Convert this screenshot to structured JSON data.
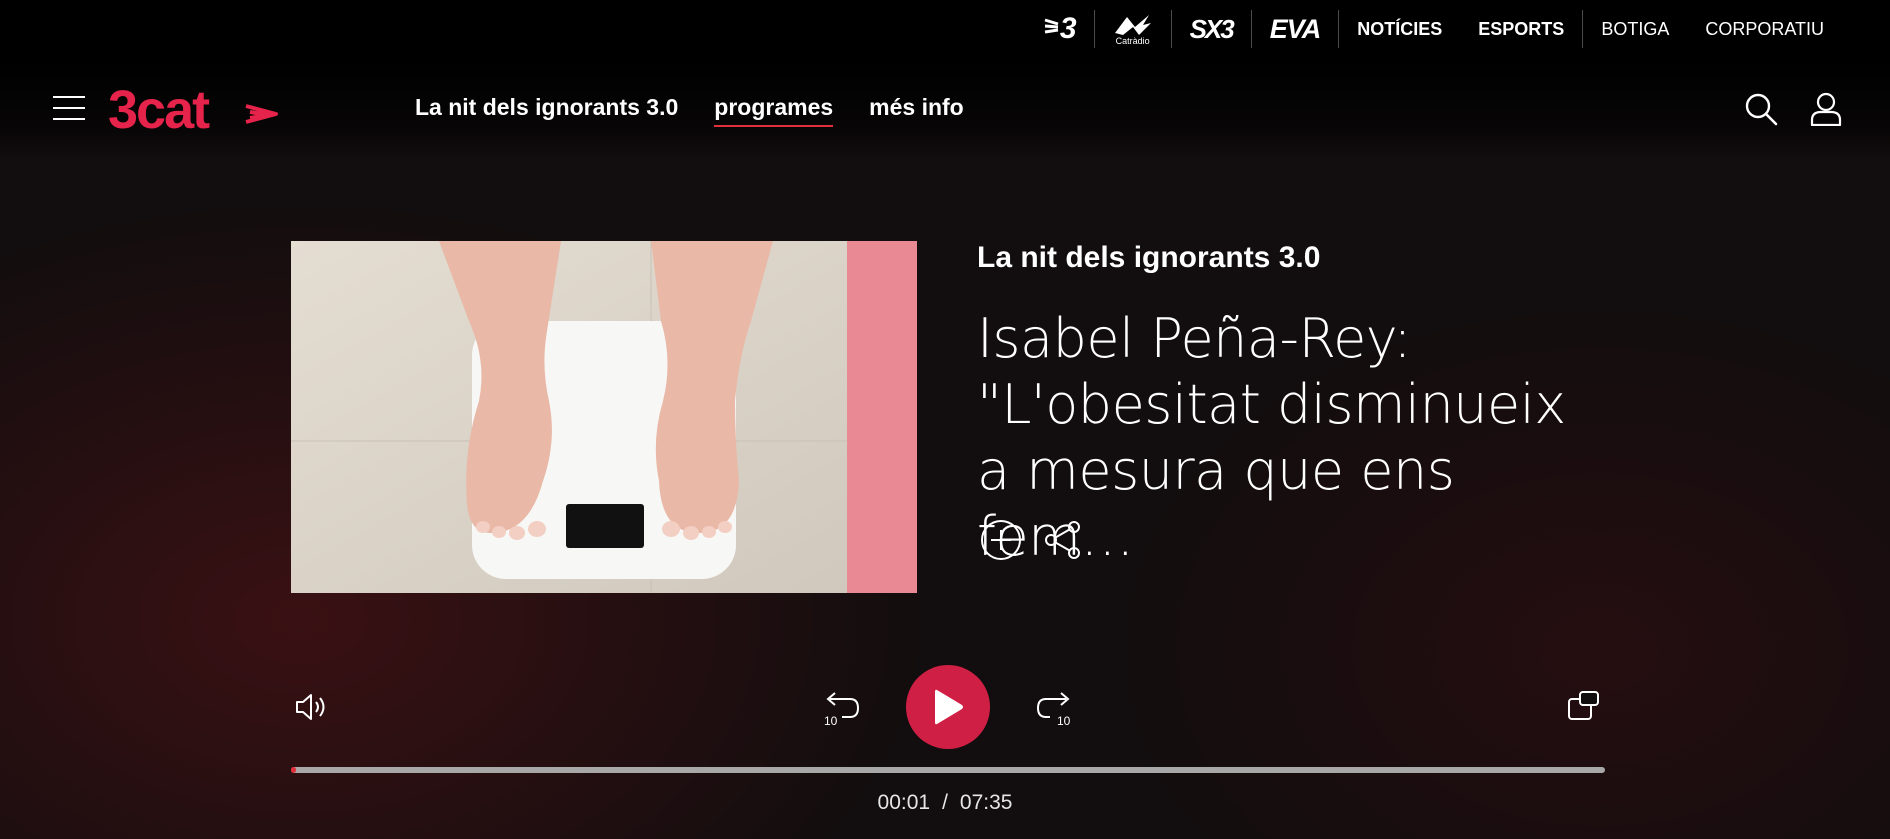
{
  "topbar": {
    "channels": [
      {
        "label": "3",
        "icon": "tv3-logo"
      },
      {
        "label": "Catràdio",
        "icon": "catradio-logo"
      },
      {
        "label": "SX3",
        "icon": "sx3-logo"
      },
      {
        "label": "EVA",
        "icon": "eva-logo"
      }
    ],
    "links": [
      {
        "label": "NOTÍCIES"
      },
      {
        "label": "ESPORTS"
      },
      {
        "label": "BOTIGA"
      },
      {
        "label": "CORPORATIU"
      }
    ]
  },
  "header": {
    "brand": "3cat",
    "nav": [
      {
        "label": "La nit dels ignorants 3.0"
      },
      {
        "label": "programes"
      },
      {
        "label": "més info"
      }
    ],
    "active_nav": "programes"
  },
  "content": {
    "program_title": "La nit dels ignorants 3.0",
    "episode_title": "Isabel Peña-Rey: \"L'obesitat disminueix a mesura que ens fem…"
  },
  "player": {
    "skip_back_label": "10",
    "skip_forward_label": "10",
    "current_time": "00:01",
    "separator": "/",
    "duration": "07:35",
    "progress_fraction": 0.0022
  },
  "colors": {
    "accent": "#d01f45",
    "brand_red": "#e6234a",
    "progress_track": "#a8a8a8"
  }
}
